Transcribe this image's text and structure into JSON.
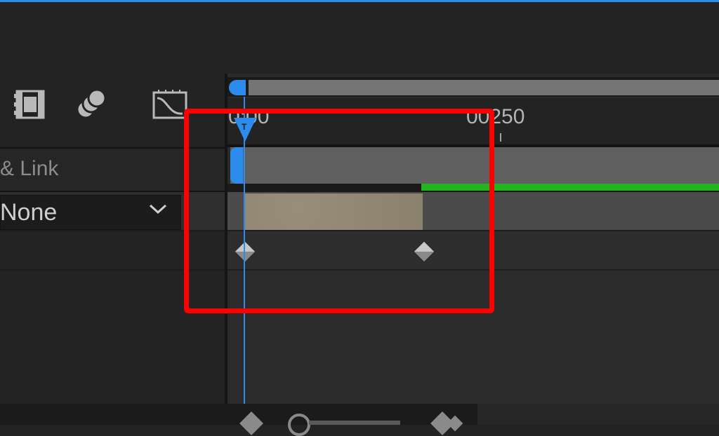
{
  "timeline": {
    "ruler_labels": [
      "0:00",
      "00250"
    ],
    "playhead_marker": "T"
  },
  "layers": {
    "link_header": "& Link",
    "parent_value": "None"
  },
  "colors": {
    "accent": "#2d8ceb",
    "highlight": "#ff0000",
    "work_area_green": "#22b522",
    "layer_bar": "#928873"
  },
  "icons": [
    "film-strip-icon",
    "layers-icon",
    "graph-editor-icon",
    "chevron-down-icon",
    "keyframe-icon",
    "zoom-out-icon",
    "zoom-in-icon"
  ]
}
